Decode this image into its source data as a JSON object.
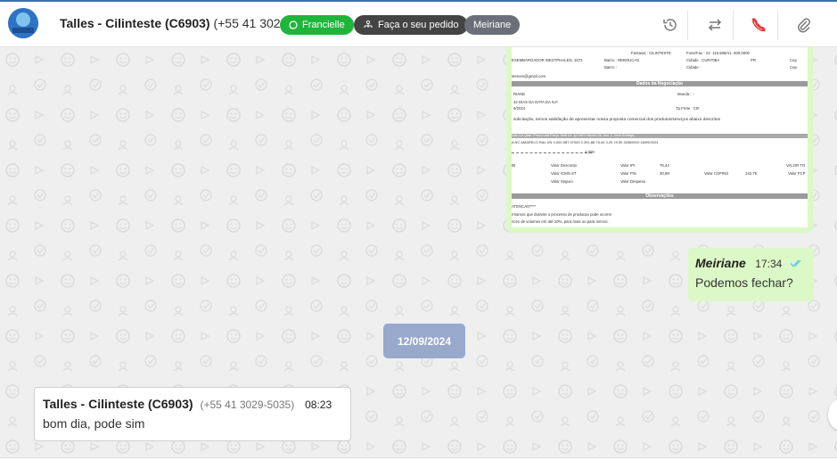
{
  "header": {
    "contact_name": "Talles - Cilinteste (C6903)",
    "contact_phone": "(+55 41 3029-5035)",
    "tags": {
      "whatsapp_user": "Francielle",
      "order": "Faça o seu pedido",
      "agent": "Meiriane"
    },
    "icons": [
      "history-icon",
      "transfer-icon",
      "end-call-icon",
      "attachment-icon"
    ]
  },
  "document": {
    "lines": {
      "fantasia_label": "Fantasia",
      "fantasia_value": "CILINTESTE",
      "fonefax_label": "Fone/Fax",
      "fonefax_value": "41- 116.508/41- 000.0000",
      "address": "ESEMBARGADOR WESTPHALEN, 1672",
      "bairro_label": "Bairro",
      "bairro_value": "REBOUCAS",
      "cidade_label": "Cidade",
      "cidade_value": "CURITIBA",
      "uf_value": "PR",
      "cep_label": "Cep",
      "email": "stenom@gmail.com",
      "section_negociacao": "Dados da Negociação",
      "vendedor": "RIANE",
      "moeda_label": "Moeda",
      "moeda_value": "-",
      "prazo": "42 DIAS DA DATA DA N.F.",
      "data": "9/2024",
      "tpfrete_label": "Tp.Frete",
      "tpfrete_value": "CIF",
      "intro": "solicitação, temos satisfação de apresentar nossa proposta comercial dos produtos/serviços abaixo descritos",
      "table_headers": "ição   Un   Qtde.   Preço Unit   Preço Total   Vlr. Ipi   %IPI   %Icms   Vlr. Icm. L.   Ncm   Entrega",
      "table_row": "A NC AMARELO RAL   UN   4,000   587,97000   2.351,88   76,44   3,25   19,50   32089010   18/09/2024",
      "total_qty": "4,000",
      "valor_desconto": "Valor Desconto",
      "valor_icms_st": "Valor ICMS-ST",
      "valor_seguro": "Valor Seguro",
      "valor_ipi_label": "Valor IPI",
      "valor_ipi": "76,44",
      "valor_pis_label": "Valor PIS",
      "valor_pis": "30,99",
      "valor_cofins_label": "Valor COFINS",
      "valor_cofins": "142,76",
      "valor_despesa": "Valor Despesa",
      "valor_t": "VALOR TO",
      "valor_fcp": "Valor FCP",
      "section_obs": "Observações",
      "atencao": "ATENCAO****",
      "obs1": "rmamos que durante o processo de producao pode ocorrer",
      "obs2": "nces de volumes em até 10%, para mais ou para menos."
    }
  },
  "messages": {
    "outgoing": {
      "sender": "Meiriane",
      "time": "17:34",
      "text": "Podemos fechar?"
    },
    "date_divider": "12/09/2024",
    "incoming": {
      "sender": "Talles - Cilinteste (C6903)",
      "phone": "(+55 41 3029-5035)",
      "time": "08:23",
      "text": "bom dia, pode sim"
    }
  },
  "colors": {
    "accent_green": "#1fb53b",
    "outgoing_bubble": "#dcf8c6",
    "date_chip": "#98a9cc",
    "check_blue": "#4fc3f7",
    "end_call_red": "#e53935"
  }
}
